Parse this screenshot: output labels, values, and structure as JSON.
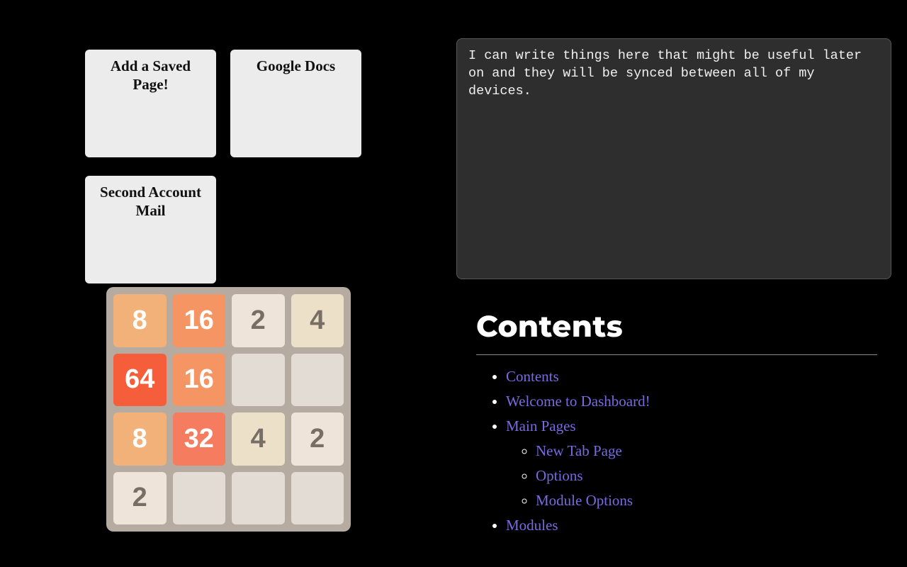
{
  "saved_pages": {
    "tiles": [
      {
        "label": "Add a Saved Page!"
      },
      {
        "label": "Google Docs"
      },
      {
        "label": "Second Account Mail"
      }
    ]
  },
  "game_2048": {
    "grid": [
      [
        8,
        16,
        2,
        4
      ],
      [
        64,
        16,
        null,
        null
      ],
      [
        8,
        32,
        4,
        2
      ],
      [
        2,
        null,
        null,
        null
      ]
    ]
  },
  "notes": {
    "text": "I can write things here that might be useful later on and they will be synced between all of my devices."
  },
  "contents": {
    "heading": "Contents",
    "links": {
      "contents": "Contents",
      "welcome": "Welcome to Dashboard!",
      "main_pages": "Main Pages",
      "new_tab": "New Tab Page",
      "options": "Options",
      "module_options": "Module Options",
      "modules": "Modules"
    }
  }
}
